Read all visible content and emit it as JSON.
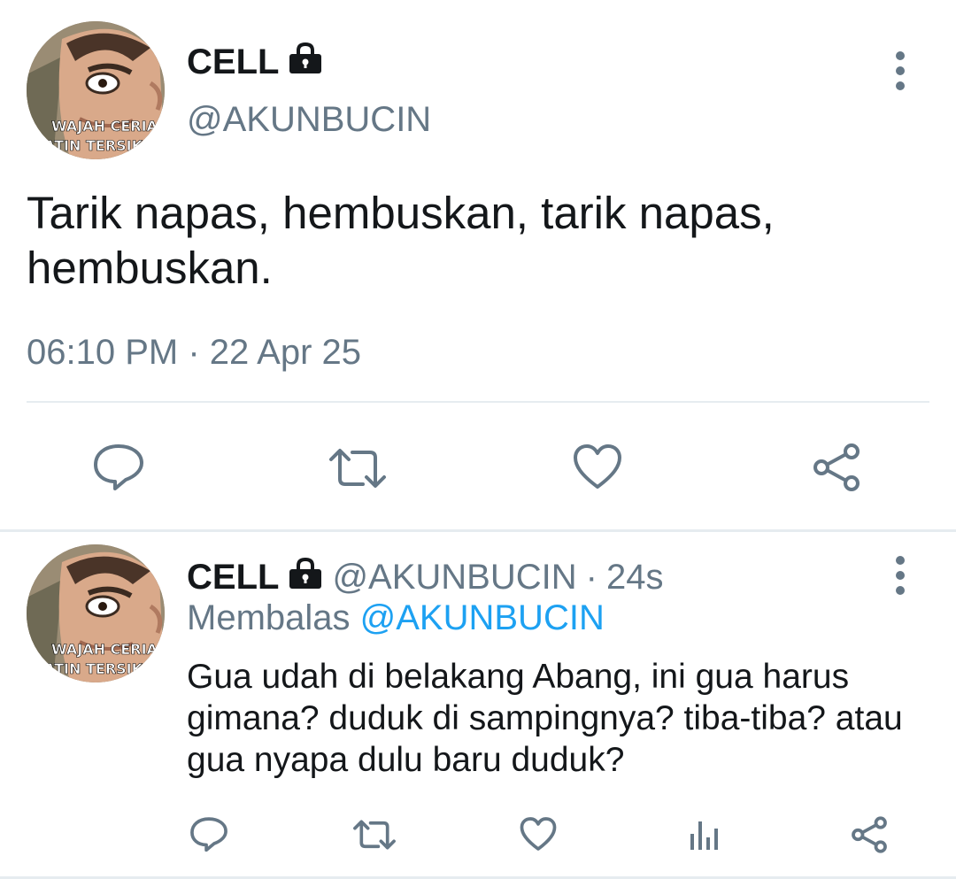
{
  "main_tweet": {
    "avatar_caption_line1": "WAJAH CERIA",
    "avatar_caption_line2": "ATIN TERSIKS",
    "display_name": "CELL",
    "handle": "@AKUNBUCIN",
    "text": "Tarik napas, hembuskan, tarik napas, hembuskan.",
    "timestamp": "06:10 PM · 22 Apr 25",
    "actions": [
      "reply-icon",
      "retweet-icon",
      "like-icon",
      "share-icon"
    ]
  },
  "reply_tweet": {
    "avatar_caption_line1": "WAJAH CERIA",
    "avatar_caption_line2": "ATIN TERSIKS",
    "display_name": "CELL",
    "handle": "@AKUNBUCIN",
    "separator": "·",
    "age": "24s",
    "replying_label": "Membalas",
    "replying_to": "@AKUNBUCIN",
    "text": "Gua udah di belakang Abang, ini gua harus gimana? duduk di sampingnya? tiba-tiba? atau gua nyapa dulu baru duduk?",
    "actions": [
      "reply-icon",
      "retweet-icon",
      "like-icon",
      "analytics-icon",
      "share-icon"
    ]
  },
  "colors": {
    "text_primary": "#14171a",
    "text_secondary": "#657786",
    "link": "#1da1f2",
    "divider": "#e6ecf0"
  }
}
